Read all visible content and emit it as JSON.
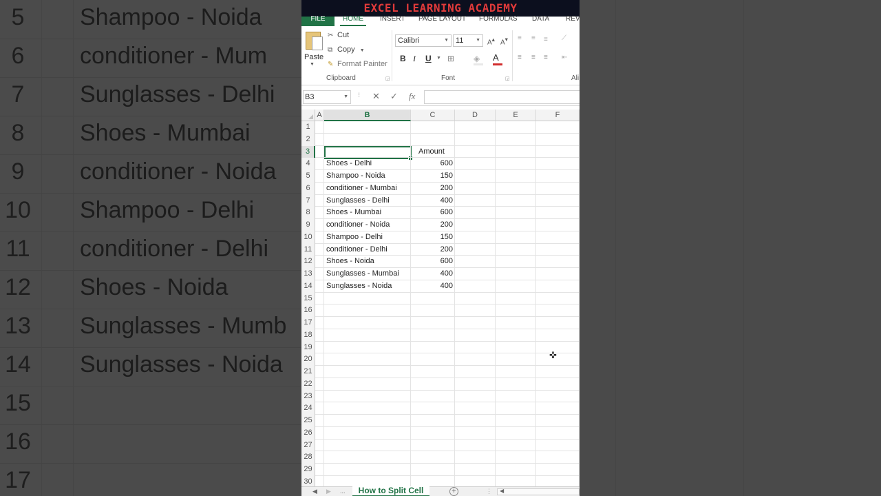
{
  "banner": "EXCEL LEARNING ACADEMY",
  "ribbon_tabs": [
    "FILE",
    "HOME",
    "INSERT",
    "PAGE LAYOUT",
    "FORMULAS",
    "DATA",
    "REV"
  ],
  "clipboard": {
    "paste": "Paste",
    "cut": "Cut",
    "copy": "Copy",
    "format_painter": "Format Painter",
    "group_label": "Clipboard"
  },
  "font": {
    "name": "Calibri",
    "size": "11",
    "group_label": "Font",
    "bold": "B",
    "italic": "I",
    "underline": "U"
  },
  "alignment": {
    "group_label": "Ali"
  },
  "formula_bar": {
    "name_box": "B3",
    "fx": "fx",
    "value": ""
  },
  "columns": [
    "A",
    "B",
    "C",
    "D",
    "E",
    "F"
  ],
  "selected_column": "B",
  "selected_row": 3,
  "rows": [
    "1",
    "2",
    "3",
    "4",
    "5",
    "6",
    "7",
    "8",
    "9",
    "10",
    "11",
    "12",
    "13",
    "14",
    "15",
    "16",
    "17",
    "18",
    "19",
    "20",
    "21",
    "22",
    "23",
    "24",
    "25",
    "26",
    "27",
    "28",
    "29",
    "30"
  ],
  "header_cell": "Amount",
  "table": [
    {
      "item": "Shoes - Delhi",
      "amount": "600"
    },
    {
      "item": "Shampoo - Noida",
      "amount": "150"
    },
    {
      "item": "conditioner - Mumbai",
      "amount": "200"
    },
    {
      "item": "Sunglasses - Delhi",
      "amount": "400"
    },
    {
      "item": "Shoes - Mumbai",
      "amount": "600"
    },
    {
      "item": "conditioner - Noida",
      "amount": "200"
    },
    {
      "item": "Shampoo - Delhi",
      "amount": "150"
    },
    {
      "item": "conditioner - Delhi",
      "amount": "200"
    },
    {
      "item": "Shoes - Noida",
      "amount": "600"
    },
    {
      "item": "Sunglasses - Mumbai",
      "amount": "400"
    },
    {
      "item": "Sunglasses - Noida",
      "amount": "400"
    }
  ],
  "sheet_tab": "How to Split Cell",
  "sheet_more": "...",
  "background_zoom": [
    {
      "row": "5",
      "text": "Shampoo - Noida"
    },
    {
      "row": "6",
      "text": "conditioner - Mum"
    },
    {
      "row": "7",
      "text": "Sunglasses - Delhi"
    },
    {
      "row": "8",
      "text": "Shoes - Mumbai"
    },
    {
      "row": "9",
      "text": "conditioner - Noida"
    },
    {
      "row": "10",
      "text": "Shampoo - Delhi"
    },
    {
      "row": "11",
      "text": "conditioner - Delhi"
    },
    {
      "row": "12",
      "text": "Shoes - Noida"
    },
    {
      "row": "13",
      "text": "Sunglasses - Mumb"
    },
    {
      "row": "14",
      "text": "Sunglasses - Noida"
    },
    {
      "row": "15",
      "text": ""
    },
    {
      "row": "16",
      "text": ""
    },
    {
      "row": "17",
      "text": ""
    }
  ],
  "colors": {
    "excel_green": "#217346",
    "banner_text": "#e03a3a",
    "banner_bg": "#0c0f1e"
  }
}
